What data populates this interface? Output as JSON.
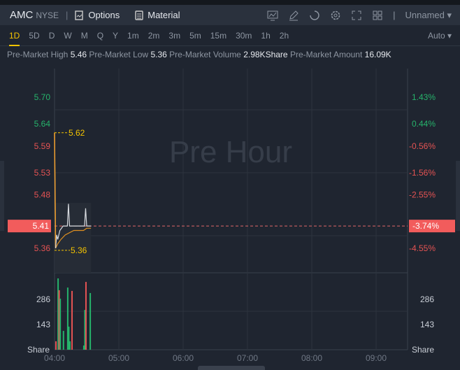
{
  "header": {
    "symbol": "AMC",
    "exchange": "NYSE",
    "options": "Options",
    "material": "Material",
    "layout": "Unnamed"
  },
  "tabs": [
    "1D",
    "5D",
    "D",
    "W",
    "M",
    "Q",
    "Y",
    "1m",
    "2m",
    "3m",
    "5m",
    "15m",
    "30m",
    "1h",
    "2h"
  ],
  "active_tab": "1D",
  "auto": "Auto",
  "info": {
    "high_label": "Pre-Market High",
    "high": "5.46",
    "low_label": "Pre-Market Low",
    "low": "5.36",
    "vol_label": "Pre-Market Volume",
    "vol": "2.98KShare",
    "amt_label": "Pre-Market Amount",
    "amt": "16.09K"
  },
  "watermark": "Pre Hour",
  "colors": {
    "up": "#26b36b",
    "down": "#e55353",
    "price": "#f0a030",
    "avg": "#e09020",
    "accent": "#f5c400"
  },
  "chart_data": {
    "type": "line",
    "price_ticks": [
      {
        "p": 5.7,
        "label": "5.70",
        "pct": "1.43%",
        "up": true
      },
      {
        "p": 5.64,
        "label": "5.64",
        "pct": "0.44%",
        "up": true
      },
      {
        "p": 5.59,
        "label": "5.59",
        "pct": "-0.56%",
        "up": false
      },
      {
        "p": 5.53,
        "label": "5.53",
        "pct": "-1.56%",
        "up": false
      },
      {
        "p": 5.48,
        "label": "5.48",
        "pct": "-2.55%",
        "up": false
      },
      {
        "p": 5.36,
        "label": "5.36",
        "pct": "-4.55%",
        "up": false
      }
    ],
    "current": {
      "p": 5.41,
      "label": "5.41",
      "pct": "-3.74%"
    },
    "high_mark": "5.62",
    "low_mark": "5.36",
    "x_ticks": [
      "04:00",
      "05:00",
      "06:00",
      "07:00",
      "08:00",
      "09:00"
    ],
    "vol_ticks": [
      {
        "v": 286,
        "label": "286"
      },
      {
        "v": 143,
        "label": "143"
      }
    ],
    "vol_unit": "Share",
    "price": [
      [
        0,
        5.62
      ],
      [
        1,
        5.36
      ],
      [
        2,
        5.39
      ],
      [
        3,
        5.38
      ],
      [
        5,
        5.4
      ],
      [
        8,
        5.41
      ],
      [
        12,
        5.41
      ],
      [
        13,
        5.46
      ],
      [
        14,
        5.41
      ],
      [
        28,
        5.41
      ],
      [
        29,
        5.45
      ],
      [
        30,
        5.41
      ],
      [
        34,
        5.41
      ]
    ],
    "avg": [
      [
        0,
        5.62
      ],
      [
        1,
        5.36
      ],
      [
        3,
        5.37
      ],
      [
        6,
        5.38
      ],
      [
        10,
        5.39
      ],
      [
        18,
        5.4
      ],
      [
        27,
        5.4
      ],
      [
        30,
        5.405
      ],
      [
        34,
        5.405
      ]
    ],
    "volume": [
      [
        1,
        48,
        "d"
      ],
      [
        3,
        405,
        "u"
      ],
      [
        4,
        338,
        "d"
      ],
      [
        5,
        290,
        "u"
      ],
      [
        8,
        107,
        "u"
      ],
      [
        12,
        353,
        "u"
      ],
      [
        13,
        131,
        "u"
      ],
      [
        14,
        48,
        "u"
      ],
      [
        16,
        334,
        "d"
      ],
      [
        27,
        24,
        "u"
      ],
      [
        28,
        226,
        "u"
      ],
      [
        29,
        385,
        "d"
      ],
      [
        33,
        322,
        "u"
      ]
    ]
  }
}
